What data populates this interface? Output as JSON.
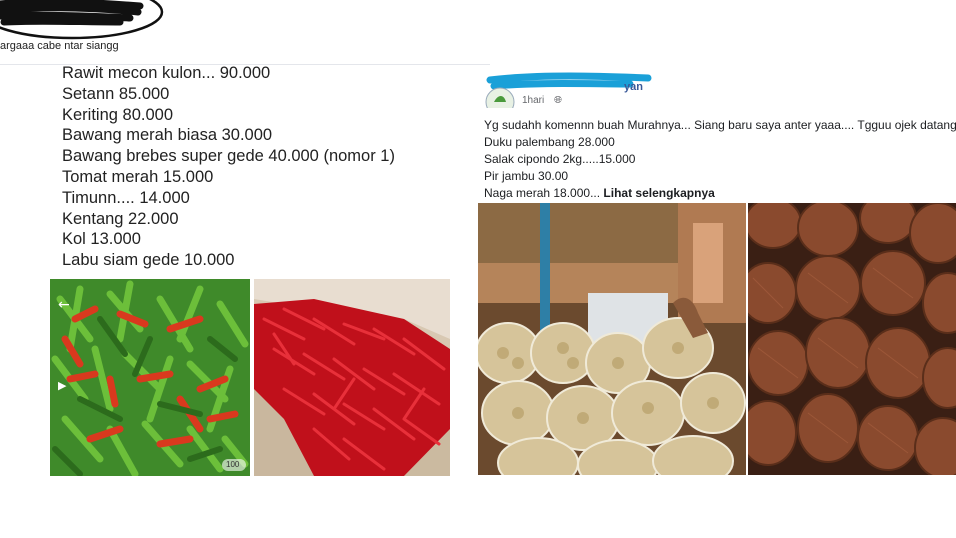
{
  "left_post": {
    "caption": "argaaa cabe ntar siangg",
    "items": [
      "Rawit mecon kulon... 90.000",
      "Setann 85.000",
      "Keriting 80.000",
      "Bawang merah biasa 30.000",
      "Bawang brebes super gede 40.000  (nomor 1)",
      "Tomat merah 15.000",
      "Timunn.... 14.000",
      "Kentang 22.000",
      "Kol 13.000",
      "Labu siam gede 10.000"
    ],
    "photo_badge": "100"
  },
  "right_post": {
    "author_tail": "yan",
    "time": "1hari",
    "lines": [
      "Yg sudahh komennn buah Murahnya... Siang baru saya anter yaaa.... Tgguu ojek datang",
      "Duku palembang 28.000",
      "Salak cipondo 2kg.....15.000",
      "Pir jambu 30.00"
    ],
    "last_line": "Naga merah 18.000...",
    "see_more": "Lihat selengkapnya"
  },
  "colors": {
    "link": "#385898",
    "muted": "#65676b"
  }
}
